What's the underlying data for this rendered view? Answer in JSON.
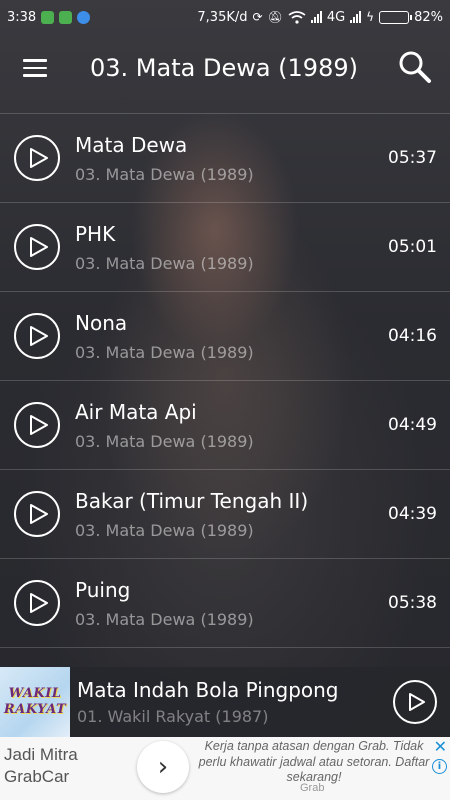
{
  "status_bar": {
    "time": "3:38",
    "net_speed": "7,35K/d",
    "network": "4G",
    "battery": "82%",
    "battery_level": 0.82
  },
  "app_bar": {
    "title": "03. Mata Dewa (1989)"
  },
  "tracks": [
    {
      "title": "Mata Dewa",
      "album": "03. Mata Dewa (1989)",
      "duration": "05:37"
    },
    {
      "title": "PHK",
      "album": "03. Mata Dewa (1989)",
      "duration": "05:01"
    },
    {
      "title": "Nona",
      "album": "03. Mata Dewa (1989)",
      "duration": "04:16"
    },
    {
      "title": "Air Mata Api",
      "album": "03. Mata Dewa (1989)",
      "duration": "04:49"
    },
    {
      "title": "Bakar (Timur Tengah II)",
      "album": "03. Mata Dewa (1989)",
      "duration": "04:39"
    },
    {
      "title": "Puing",
      "album": "03. Mata Dewa (1989)",
      "duration": "05:38"
    }
  ],
  "now_playing": {
    "cover_text_line1": "WAKIL",
    "cover_text_line2": "RAKYAT",
    "title": "Mata Indah Bola Pingpong",
    "album": "01. Wakil Rakyat (1987)"
  },
  "ad": {
    "headline_line1": "Jadi Mitra",
    "headline_line2": "GrabCar",
    "body": "Kerja tanpa atasan dengan Grab. Tidak perlu khawatir jadwal atau setoran. Daftar sekarang!",
    "brand": "Grab"
  },
  "colors": {
    "battery_fill": "#35d442",
    "ad_accent": "#1a8fd8"
  }
}
